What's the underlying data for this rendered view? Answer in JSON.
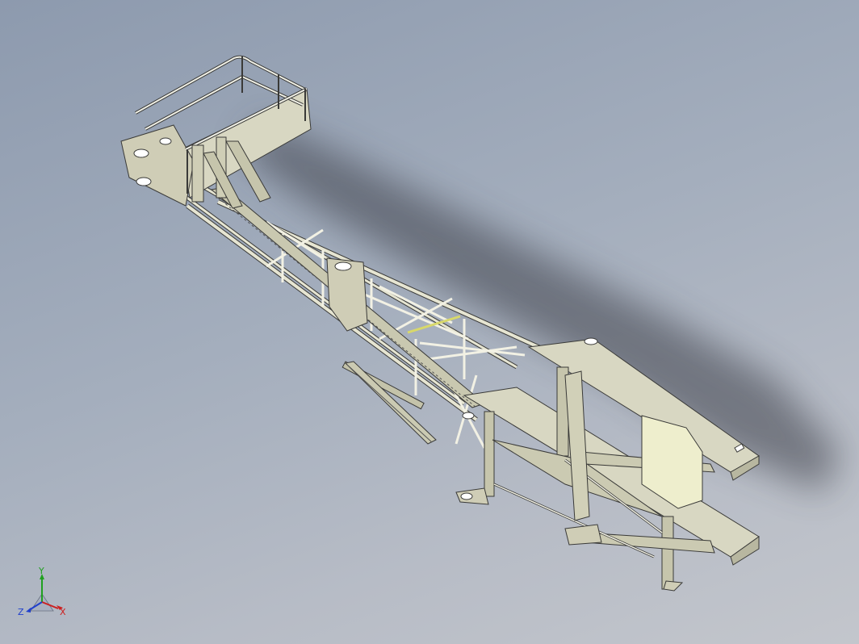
{
  "view": {
    "background_top": "#8d9aae",
    "background_bottom": "#c3c6cc",
    "model_fill": "#d4d3bd",
    "model_edge": "#3a3a38",
    "accent_yellow": "#d8d86a",
    "panel_fill": "#eeeecd"
  },
  "triad": {
    "x_label": "X",
    "y_label": "Y",
    "z_label": "Z",
    "x_color": "#cc2020",
    "y_color": "#20a020",
    "z_color": "#2040cc"
  }
}
